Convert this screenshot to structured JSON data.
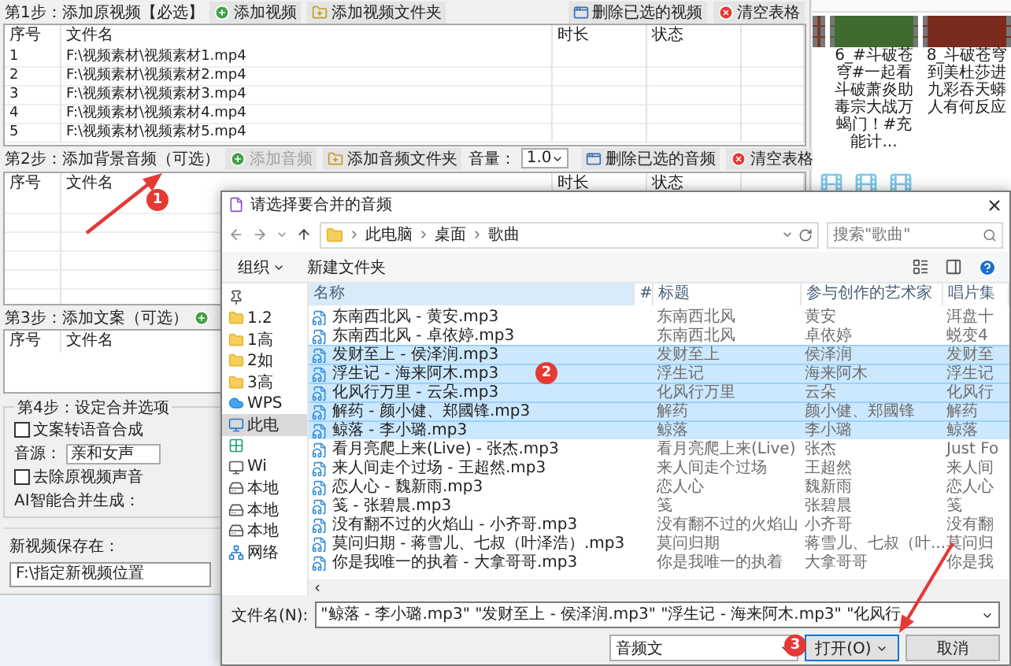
{
  "app": {
    "step1": {
      "title": "第1步：添加原视频【必选】",
      "buttons": [
        {
          "label": "添加视频",
          "kind": "add",
          "disabled": false
        },
        {
          "label": "添加视频文件夹",
          "kind": "folder",
          "disabled": false
        }
      ],
      "buttons_right": [
        {
          "label": "删除已选的视频",
          "kind": "remove",
          "disabled": false
        },
        {
          "label": "清空表格",
          "kind": "clear",
          "disabled": false
        }
      ],
      "columns": [
        "序号",
        "文件名",
        "时长",
        "状态"
      ],
      "rows": [
        [
          "1",
          "F:\\视频素材\\视频素材1.mp4"
        ],
        [
          "2",
          "F:\\视频素材\\视频素材2.mp4"
        ],
        [
          "3",
          "F:\\视频素材\\视频素材3.mp4"
        ],
        [
          "4",
          "F:\\视频素材\\视频素材4.mp4"
        ],
        [
          "5",
          "F:\\视频素材\\视频素材5.mp4"
        ]
      ]
    },
    "step2": {
      "title": "第2步：添加背景音频（可选）",
      "buttons": [
        {
          "label": "添加音频",
          "kind": "add",
          "disabled": true
        },
        {
          "label": "添加音频文件夹",
          "kind": "folder",
          "disabled": false
        }
      ],
      "volume": {
        "label": "音量：",
        "value": "1.0"
      },
      "buttons_right": [
        {
          "label": "删除已选的音频",
          "kind": "remove",
          "disabled": false
        },
        {
          "label": "清空表格",
          "kind": "clear",
          "disabled": false
        }
      ],
      "columns": [
        "序号",
        "文件名",
        "时长",
        "状态"
      ]
    },
    "step3": {
      "title": "第3步：添加文案（可选）",
      "columns": [
        "序号",
        "文件名"
      ]
    },
    "step4": {
      "title": "第4步：设定合并选项",
      "tts": {
        "label": "文案转语音合成",
        "checked": false
      },
      "voice": {
        "label": "音源：",
        "value": "亲和女声"
      },
      "mute": {
        "label": "去除原视频声音",
        "checked": false
      },
      "ai_label": "AI智能合并生成："
    },
    "save": {
      "label": "新视频保存在：",
      "value": "F:\\指定新视频位置"
    }
  },
  "explorer": {
    "tiles": [
      {
        "caption": "6_#斗破苍穹#一起看斗破萧炎助毒宗大战万蝎门！#充能计..."
      },
      {
        "caption": "8_斗破苍穹到美杜莎进九彩吞天蟒人有何反应"
      }
    ]
  },
  "dialog": {
    "title": "请选择要合并的音频",
    "path": [
      "此电脑",
      "桌面",
      "歌曲"
    ],
    "search": {
      "placeholder": "搜索\"歌曲\""
    },
    "organize": "组织",
    "new_folder": "新建文件夹",
    "nav": [
      {
        "kind": "quick",
        "selected": false
      },
      {
        "kind": "folder",
        "label": "1.2",
        "selected": false
      },
      {
        "kind": "folder",
        "label": "1高",
        "selected": false
      },
      {
        "kind": "folder",
        "label": "2如",
        "selected": false
      },
      {
        "kind": "folder",
        "label": "3高",
        "selected": false
      },
      {
        "kind": "cloud",
        "label": "WPS",
        "selected": false
      },
      {
        "kind": "pc",
        "label": "此电",
        "selected": true
      },
      {
        "kind": "app",
        "selected": false
      },
      {
        "kind": "desktop",
        "label": "Wi",
        "selected": false
      },
      {
        "kind": "drive",
        "label": "本地",
        "selected": false
      },
      {
        "kind": "drive",
        "label": "本地",
        "selected": false
      },
      {
        "kind": "drive",
        "label": "本地",
        "selected": false
      },
      {
        "kind": "network",
        "label": "网络",
        "selected": false
      }
    ],
    "columns": [
      "名称",
      "#",
      "标题",
      "参与创作的艺术家",
      "唱片集"
    ],
    "rows": [
      {
        "name": "东南西北风 - 黄安.mp3",
        "title": "东南西北风",
        "artist": "黄安",
        "album": "洱盘十",
        "selected": false
      },
      {
        "name": "东南西北风 - 卓依婷.mp3",
        "title": "东南西北风",
        "artist": "卓依婷",
        "album": "蜕变4",
        "selected": false
      },
      {
        "name": "发财至上 - 侯泽润.mp3",
        "title": "发财至上",
        "artist": "侯泽润",
        "album": "发财至",
        "selected": true
      },
      {
        "name": "浮生记 - 海来阿木.mp3",
        "title": "浮生记",
        "artist": "海来阿木",
        "album": "浮生记",
        "selected": true
      },
      {
        "name": "化风行万里 - 云朵.mp3",
        "title": "化风行万里",
        "artist": "云朵",
        "album": "化风行",
        "selected": true
      },
      {
        "name": "解药 - 颜小健、郑國锋.mp3",
        "title": "解药",
        "artist": "颜小健、郑國锋",
        "album": "解药",
        "selected": true
      },
      {
        "name": "鲸落 - 李小璐.mp3",
        "title": "鲸落",
        "artist": "李小璐",
        "album": "鲸落",
        "selected": true
      },
      {
        "name": "看月亮爬上来(Live) - 张杰.mp3",
        "title": "看月亮爬上来(Live)",
        "artist": "张杰",
        "album": "Just Fo",
        "selected": false
      },
      {
        "name": "来人间走个过场 - 王超然.mp3",
        "title": "来人间走个过场",
        "artist": "王超然",
        "album": "来人间",
        "selected": false
      },
      {
        "name": "恋人心 - 魏新雨.mp3",
        "title": "恋人心",
        "artist": "魏新雨",
        "album": "恋人心",
        "selected": false
      },
      {
        "name": "笺 - 张碧晨.mp3",
        "title": "笺",
        "artist": "张碧晨",
        "album": "笺",
        "selected": false
      },
      {
        "name": "没有翻不过的火焰山 - 小齐哥.mp3",
        "title": "没有翻不过的火焰山",
        "artist": "小齐哥",
        "album": "没有翻",
        "selected": false
      },
      {
        "name": "莫问归期 - 蒋雪儿、七叔（叶泽浩）.mp3",
        "title": "莫问归期",
        "artist": "蒋雪儿、七叔（叶...",
        "album": "莫问归",
        "selected": false
      },
      {
        "name": "你是我唯一的执着 - 大拿哥哥.mp3",
        "title": "你是我唯一的执着",
        "artist": "大拿哥哥",
        "album": "你是我",
        "selected": false
      }
    ],
    "filename": {
      "label": "文件名(N):",
      "value": "\"鲸落 - 李小璐.mp3\" \"发财至上 - 侯泽润.mp3\" \"浮生记 - 海来阿木.mp3\" \"化风行"
    },
    "filetype": "音频文",
    "open": "打开(O)",
    "cancel": "取消"
  },
  "annotations": [
    {
      "label": "1"
    },
    {
      "label": "2"
    },
    {
      "label": "3"
    }
  ]
}
